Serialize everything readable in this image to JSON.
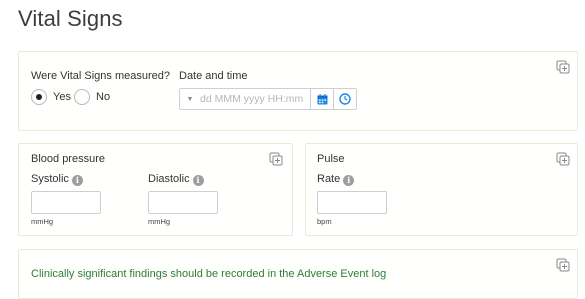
{
  "page": {
    "title": "Vital Signs"
  },
  "measured_section": {
    "question": "Were Vital Signs measured?",
    "options": [
      {
        "label": "Yes",
        "checked": true
      },
      {
        "label": "No",
        "checked": false
      }
    ],
    "datetime": {
      "label": "Date and time",
      "placeholder": "dd MMM yyyy HH:mm",
      "value": ""
    }
  },
  "blood_pressure": {
    "title": "Blood pressure",
    "systolic": {
      "label": "Systolic",
      "unit": "mmHg",
      "value": ""
    },
    "diastolic": {
      "label": "Diastolic",
      "unit": "mmHg",
      "value": ""
    }
  },
  "pulse": {
    "title": "Pulse",
    "rate": {
      "label": "Rate",
      "unit": "bpm",
      "value": ""
    }
  },
  "notice": {
    "text": "Clinically significant findings should be recorded in the Adverse Event log"
  },
  "icons": {
    "copy": "copy-plus-icon",
    "info": "info-icon",
    "calendar": "calendar-icon",
    "clock": "clock-icon",
    "caret": "caret-down-icon"
  },
  "colors": {
    "accent_blue": "#1e88e5",
    "notice_green": "#2e7d32",
    "card_border": "#e7ecd9"
  }
}
